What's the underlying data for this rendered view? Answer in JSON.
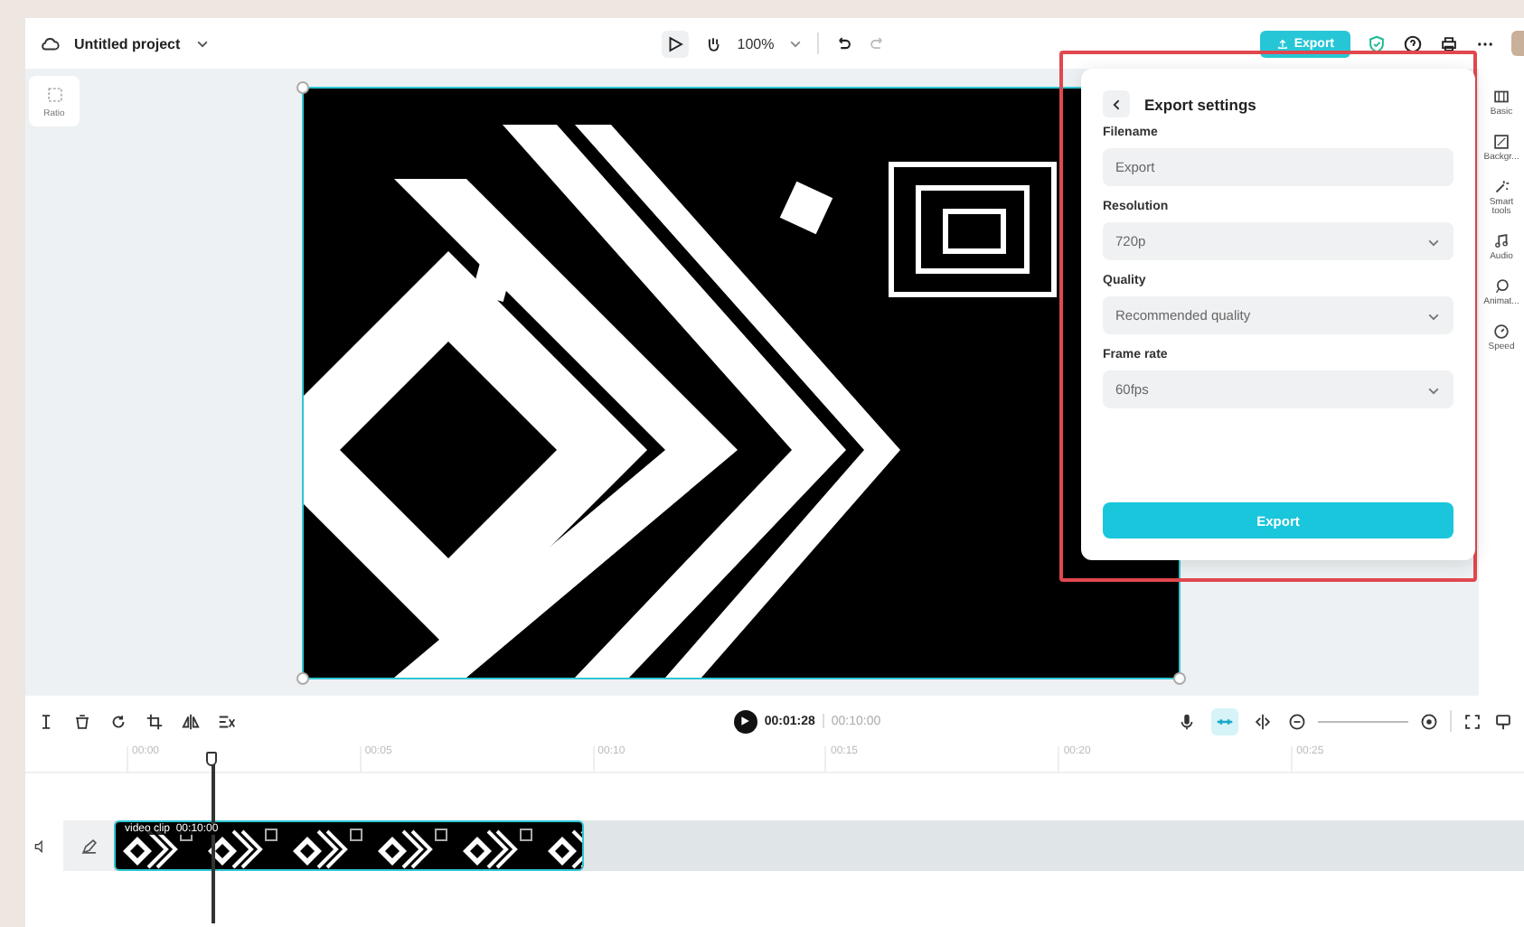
{
  "top_bar": {
    "project_title": "Untitled project",
    "zoom": "100%",
    "export_button": "Export"
  },
  "left_tools": [
    {
      "label": "Ratio"
    }
  ],
  "export_panel": {
    "title": "Export settings",
    "fields": [
      {
        "label": "Filename",
        "kind": "text",
        "value": "Export"
      },
      {
        "label": "Resolution",
        "kind": "select",
        "value": "720p"
      },
      {
        "label": "Quality",
        "kind": "select",
        "value": "Recommended quality"
      },
      {
        "label": "Frame rate",
        "kind": "select",
        "value": "60fps"
      }
    ],
    "export_button": "Export"
  },
  "side_panel": {
    "items": [
      {
        "kind": "basic",
        "label": "Basic"
      },
      {
        "kind": "background",
        "label": "Backgr..."
      },
      {
        "kind": "smart",
        "label": "Smart tools"
      },
      {
        "kind": "audio",
        "label": "Audio"
      },
      {
        "kind": "animation",
        "label": "Animat..."
      },
      {
        "kind": "speed",
        "label": "Speed"
      }
    ]
  },
  "timeline": {
    "current_time": "00:01:28",
    "total_time": "00:10:00",
    "right_tools": [
      {
        "kind": "mic",
        "on": false
      },
      {
        "kind": "magnet",
        "on": true
      },
      {
        "kind": "split",
        "on": false
      }
    ],
    "ticks": [
      "00:00",
      "00:05",
      "00:10",
      "00:15",
      "00:20",
      "00:25"
    ],
    "zoom_slider": {
      "level": 1
    },
    "clip_label": "video clip  00:10:00"
  }
}
